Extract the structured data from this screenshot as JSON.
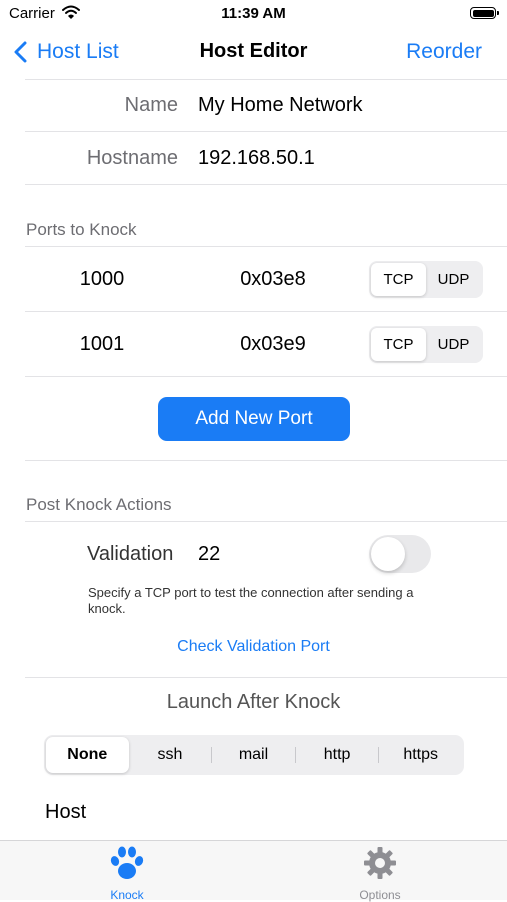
{
  "status_bar": {
    "carrier": "Carrier",
    "time": "11:39 AM"
  },
  "nav": {
    "back_label": "Host List",
    "title": "Host Editor",
    "right_label": "Reorder"
  },
  "fields": [
    {
      "label": "Name",
      "value": "My Home Network"
    },
    {
      "label": "Hostname",
      "value": "192.168.50.1"
    }
  ],
  "ports_section": {
    "header": "Ports to Knock",
    "ports": [
      {
        "number": "1000",
        "hex": "0x03e8",
        "protocol_options": [
          "TCP",
          "UDP"
        ],
        "selected": "TCP"
      },
      {
        "number": "1001",
        "hex": "0x03e9",
        "protocol_options": [
          "TCP",
          "UDP"
        ],
        "selected": "TCP"
      }
    ],
    "add_button": "Add New Port"
  },
  "post_knock": {
    "header": "Post Knock Actions",
    "validation_label": "Validation",
    "validation_value": "22",
    "validation_enabled": false,
    "note": "Specify a TCP port to test the connection after sending a knock.",
    "check_link": "Check Validation Port"
  },
  "launch": {
    "title": "Launch After Knock",
    "options": [
      "None",
      "ssh",
      "mail",
      "http",
      "https"
    ],
    "selected": "None",
    "host_label": "Host"
  },
  "tabbar": {
    "accent": "#1a7cf5",
    "inactive": "#8e8e93",
    "items": [
      {
        "label": "Knock",
        "icon": "paw-icon",
        "active": true
      },
      {
        "label": "Options",
        "icon": "gear-icon",
        "active": false
      }
    ]
  }
}
